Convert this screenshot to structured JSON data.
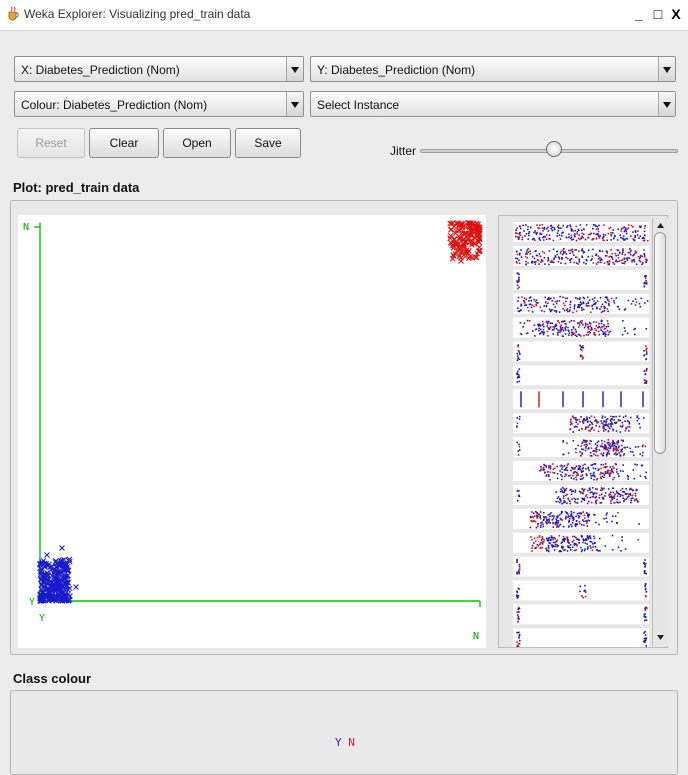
{
  "window": {
    "title": "Weka Explorer: Visualizing pred_train data",
    "minimize": "_",
    "maximize": "□",
    "close": "X"
  },
  "selectors": {
    "x_axis": "X: Diabetes_Prediction (Nom)",
    "y_axis": "Y: Diabetes_Prediction (Nom)",
    "colour": "Colour: Diabetes_Prediction (Nom)",
    "instance": "Select Instance"
  },
  "buttons": {
    "reset": "Reset",
    "clear": "Clear",
    "open": "Open",
    "save": "Save"
  },
  "jitter": {
    "label": "Jitter",
    "level": 0.52
  },
  "plot": {
    "title": "Plot: pred_train data",
    "y_top_label": "N",
    "y_bottom_label": "Y",
    "x_left_label": "Y",
    "x_right_label": "N"
  },
  "class_colour": {
    "title": "Class colour",
    "legend": [
      {
        "label": "Y",
        "color": "#2222cc"
      },
      {
        "label": "N",
        "color": "#dd2222"
      }
    ]
  },
  "colors": {
    "class_y": "#1a1acc",
    "class_n": "#e01010",
    "axis": "#00cc00"
  },
  "icons": {
    "app": "java-cup-icon",
    "scroll_up": "triangle-up-icon",
    "scroll_down": "triangle-down-icon"
  }
}
